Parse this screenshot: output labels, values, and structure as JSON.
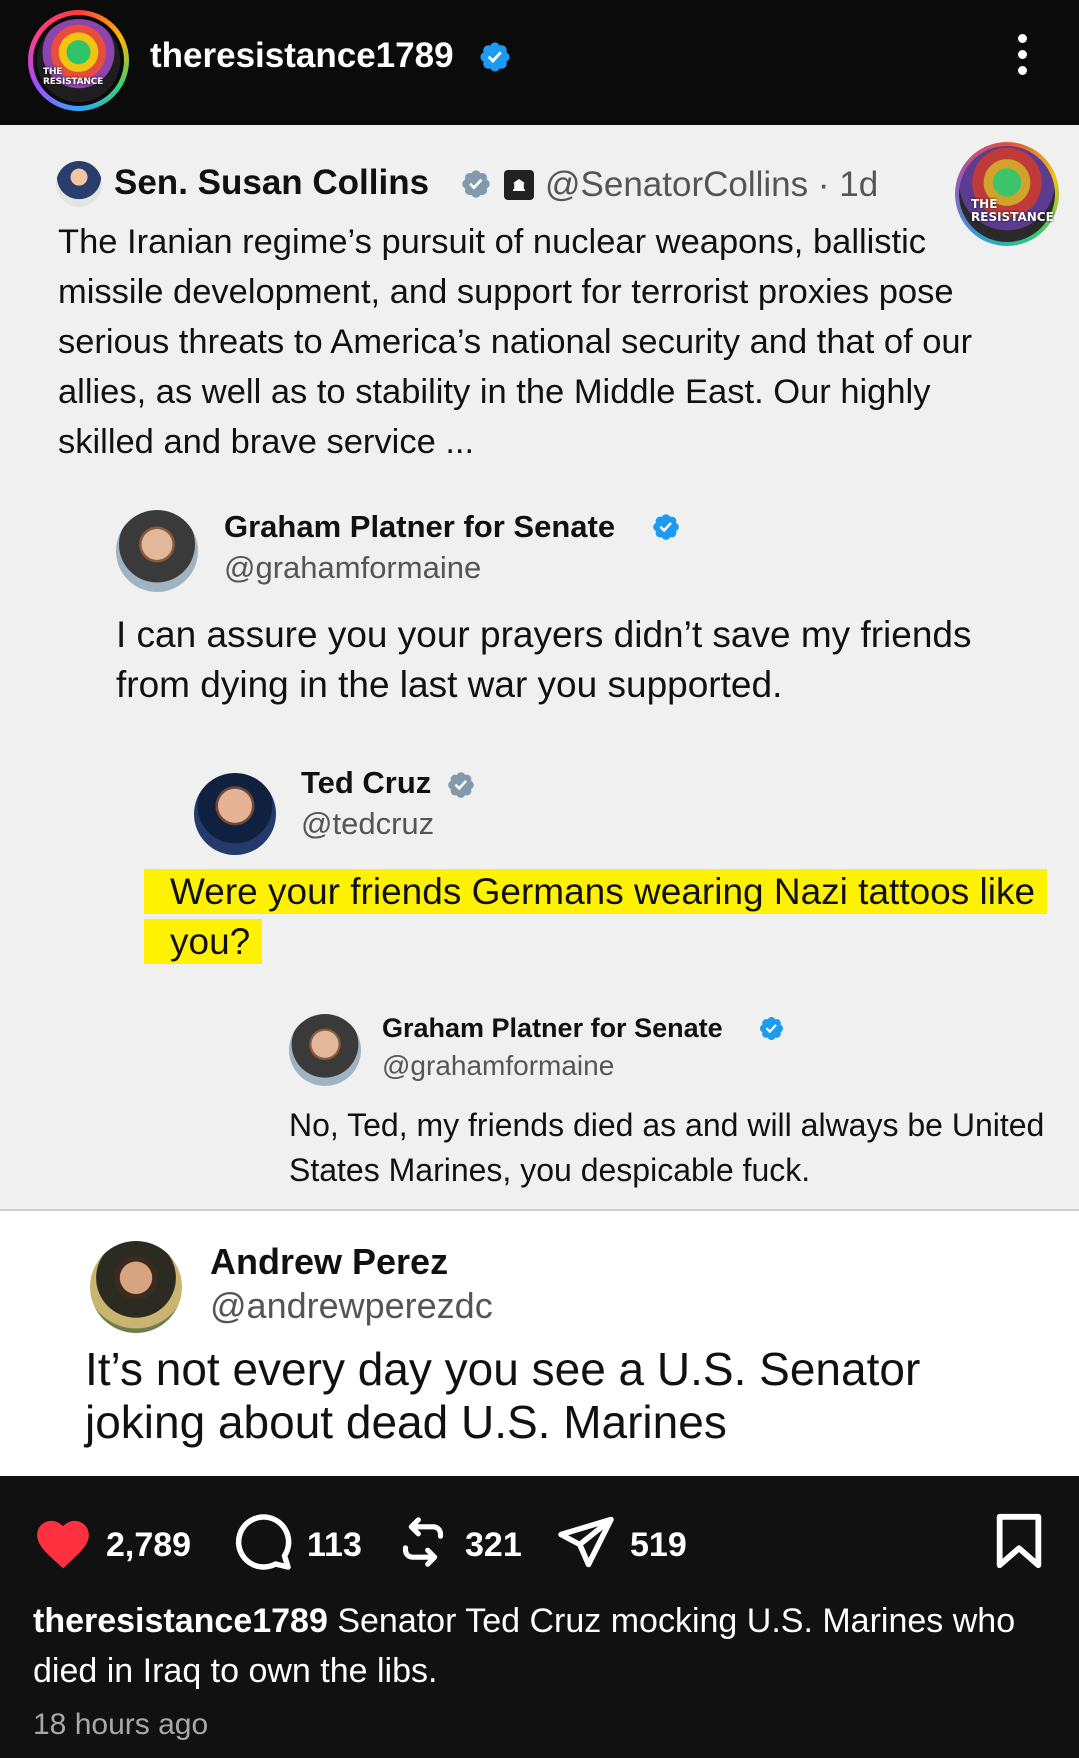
{
  "header": {
    "username": "theresistance1789",
    "avatar_text": "THE RESISTANCE",
    "more_icon": "vertical-ellipsis-icon"
  },
  "tweets": {
    "collins": {
      "name": "Sen. Susan Collins",
      "handle": "@SenatorCollins · 1d",
      "body": "The Iranian regime’s pursuit of nuclear weapons, ballistic missile development, and support for terrorist proxies pose serious threats to America’s national security and that of our allies, as well as to stability in the Middle East. Our highly skilled and brave service ..."
    },
    "watermark": "THE RESISTANCE",
    "platner_1": {
      "name": "Graham Platner for Senate",
      "handle": "@grahamformaine",
      "body": "I can assure you your prayers didn’t save my friends from dying in the last war you supported."
    },
    "cruz": {
      "name": "Ted Cruz",
      "handle": "@tedcruz",
      "body": "Were your friends Germans wearing Nazi tattoos like you?",
      "highlight_color": "#fff200"
    },
    "platner_2": {
      "name": "Graham Platner for Senate",
      "handle": "@grahamformaine",
      "body": "No, Ted, my friends died as and will always be United States Marines, you despicable fuck."
    },
    "perez": {
      "name": "Andrew Perez",
      "handle": "@andrewperezdc",
      "body": "It’s not every day you see a U.S. Senator joking about dead U.S. Marines"
    }
  },
  "actions": {
    "likes": "2,789",
    "comments": "113",
    "reposts": "321",
    "shares": "519",
    "like_color": "#ff3040"
  },
  "caption": {
    "username": "theresistance1789",
    "text": " Senator Ted Cruz mocking U.S. Marines who died in Iraq to own the libs."
  },
  "timestamp": "18 hours ago",
  "colors": {
    "verified": "#1d9bf0",
    "verified_gray": "#829aab"
  }
}
